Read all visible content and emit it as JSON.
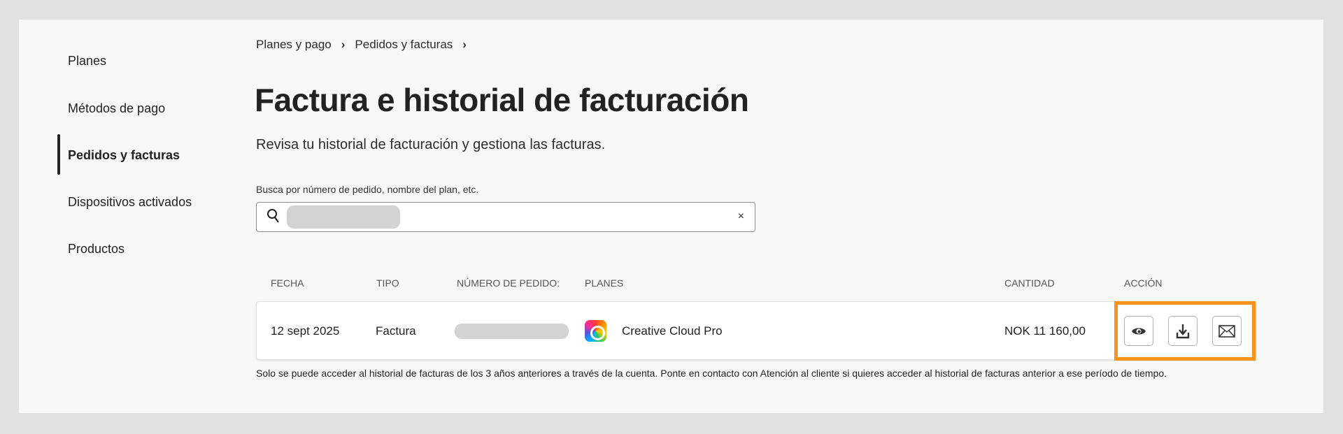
{
  "sidebar": {
    "items": [
      {
        "label": "Planes"
      },
      {
        "label": "Métodos de pago"
      },
      {
        "label": "Pedidos y facturas",
        "active": true
      },
      {
        "label": "Dispositivos activados"
      },
      {
        "label": "Productos"
      }
    ]
  },
  "breadcrumb": [
    "Planes y pago",
    "Pedidos y facturas"
  ],
  "title": "Factura e historial de facturación",
  "subtitle": "Revisa tu historial de facturación y gestiona las facturas.",
  "search": {
    "label": "Busca por número de pedido, nombre del plan, etc.",
    "clear": "×"
  },
  "table": {
    "headers": [
      "Fecha",
      "Tipo",
      "Número de pedido:",
      "Planes",
      "Cantidad",
      "Acción"
    ],
    "rows": [
      {
        "fecha": "12 sept 2025",
        "tipo": "Factura",
        "plan": "Creative Cloud Pro",
        "cantidad": "NOK 11 160,00",
        "actions": [
          "eye-icon",
          "download-icon",
          "mail-icon"
        ]
      }
    ]
  },
  "footnote": "Solo se puede acceder al historial de facturas de los 3 años anteriores a través de la cuenta. Ponte en contacto con Atención al cliente si quieres acceder al historial de facturas anterior a ese período de tiempo.",
  "colors": {
    "highlight": "#f7941d"
  }
}
